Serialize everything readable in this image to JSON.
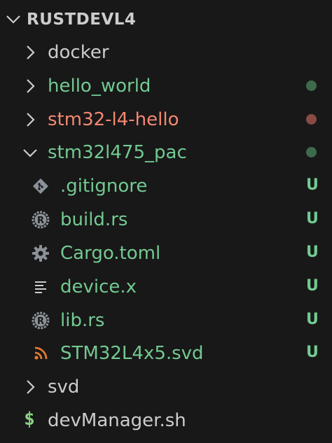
{
  "explorer": {
    "root": {
      "label": "RUSTDEVL4",
      "expanded": true
    },
    "items": [
      {
        "label": "docker",
        "type": "folder",
        "expanded": false,
        "color": "default"
      },
      {
        "label": "hello_world",
        "type": "folder",
        "expanded": false,
        "color": "green",
        "decoration": "green-dot"
      },
      {
        "label": "stm32-l4-hello",
        "type": "folder",
        "expanded": false,
        "color": "red",
        "decoration": "red-dot"
      },
      {
        "label": "stm32l475_pac",
        "type": "folder",
        "expanded": true,
        "color": "green",
        "decoration": "green-dot"
      },
      {
        "label": ".gitignore",
        "type": "file",
        "icon": "git-icon",
        "color": "green",
        "badge": "U"
      },
      {
        "label": "build.rs",
        "type": "file",
        "icon": "rust-icon",
        "color": "green",
        "badge": "U"
      },
      {
        "label": "Cargo.toml",
        "type": "file",
        "icon": "gear-icon",
        "color": "green",
        "badge": "U"
      },
      {
        "label": "device.x",
        "type": "file",
        "icon": "text-lines-icon",
        "color": "green",
        "badge": "U"
      },
      {
        "label": "lib.rs",
        "type": "file",
        "icon": "rust-icon",
        "color": "green",
        "badge": "U"
      },
      {
        "label": "STM32L4x5.svd",
        "type": "file",
        "icon": "rss-icon",
        "color": "green",
        "badge": "U"
      },
      {
        "label": "svd",
        "type": "folder",
        "expanded": false,
        "color": "default"
      },
      {
        "label": "devManager.sh",
        "type": "file",
        "icon": "dollar-icon",
        "color": "default"
      }
    ]
  },
  "colors": {
    "background": "#181818",
    "text": "#cccccc",
    "untracked": "#73c991",
    "modified_error": "#f48771",
    "rss_orange": "#e37933",
    "shell_green": "#89d185",
    "icon_gray": "#8b9199"
  }
}
